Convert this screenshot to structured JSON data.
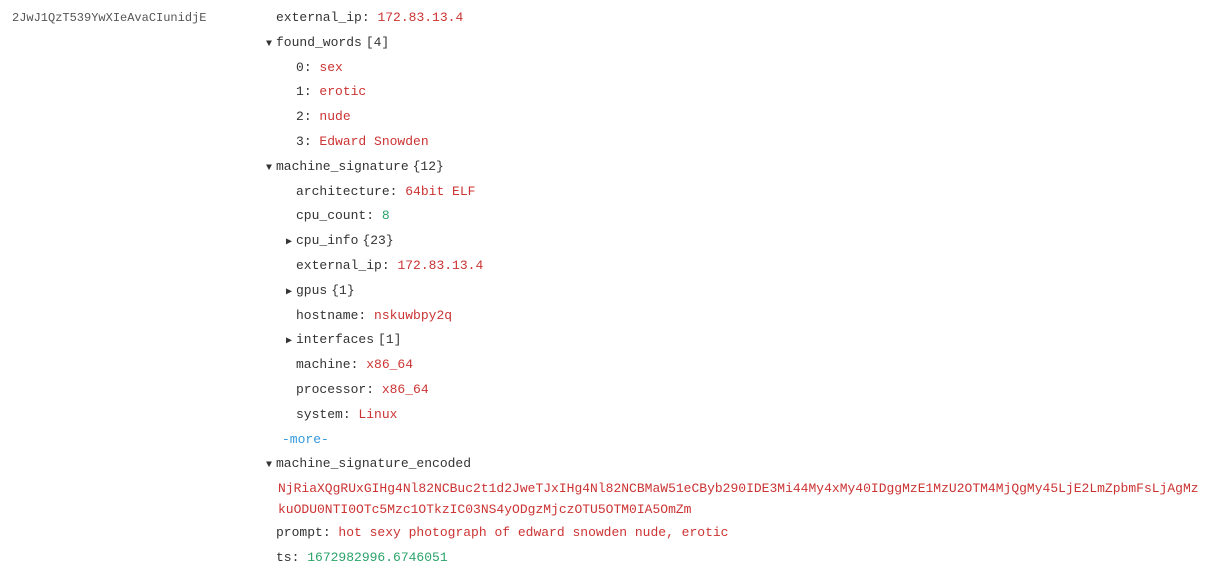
{
  "record_id": "2JwJ1QzT539YwXIeAvaCIunidjE",
  "root": {
    "external_ip": "172.83.13.4",
    "found_words_count": "[4]",
    "found_words": [
      {
        "idx": "0",
        "val": "sex"
      },
      {
        "idx": "1",
        "val": "erotic"
      },
      {
        "idx": "2",
        "val": "nude"
      },
      {
        "idx": "3",
        "val": "Edward Snowden"
      }
    ],
    "machine_signature_count": "{12}",
    "machine_signature": {
      "architecture": "64bit ELF",
      "cpu_count": "8",
      "cpu_info_count": "{23}",
      "external_ip": "172.83.13.4",
      "gpus_count": "{1}",
      "hostname": "nskuwbpy2q",
      "interfaces_count": "[1]",
      "machine": "x86_64",
      "processor": "x86_64",
      "system": "Linux",
      "more": "-more-"
    },
    "machine_signature_encoded": "NjRiaXQgRUxGIHg4Nl82NCBuc2t1d2JweTJxIHg4Nl82NCBMaW51eCByb290IDE3Mi44My4xMy40IDggMzE1MzU2OTM4MjQgMy45LjE2LmZpbmFsLjAgMzkuODU0NTI0OTc5Mzc1OTkzIC03NS4yODgzMjczOTU5OTM0IA5OmZm",
    "prompt": "hot sexy photograph of edward snowden nude, erotic",
    "ts": "1672982996.6746051"
  },
  "labels": {
    "external_ip": "external_ip",
    "found_words": "found_words",
    "machine_signature": "machine_signature",
    "architecture": "architecture",
    "cpu_count": "cpu_count",
    "cpu_info": "cpu_info",
    "gpus": "gpus",
    "hostname": "hostname",
    "interfaces": "interfaces",
    "machine": "machine",
    "processor": "processor",
    "system": "system",
    "machine_signature_encoded": "machine_signature_encoded",
    "prompt": "prompt",
    "ts": "ts"
  }
}
